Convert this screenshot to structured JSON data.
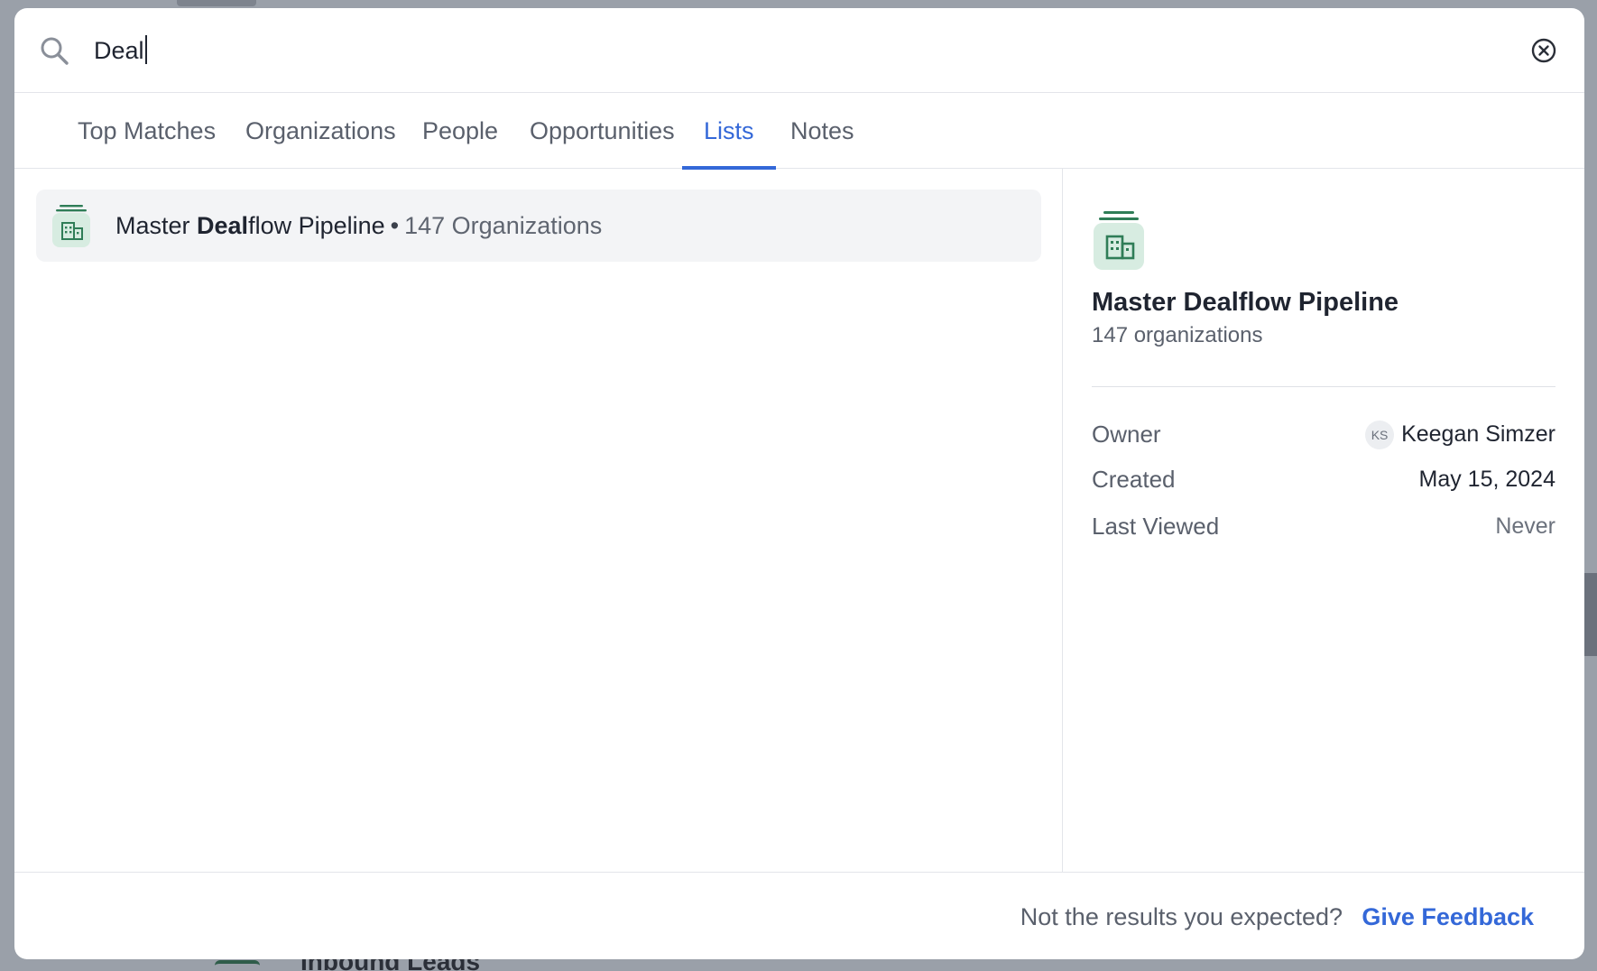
{
  "search": {
    "value": "Deal"
  },
  "tabs": [
    {
      "label": "Top Matches",
      "active": false
    },
    {
      "label": "Organizations",
      "active": false
    },
    {
      "label": "People",
      "active": false
    },
    {
      "label": "Opportunities",
      "active": false
    },
    {
      "label": "Lists",
      "active": true
    },
    {
      "label": "Notes",
      "active": false
    }
  ],
  "results": [
    {
      "name_prefix": "Master ",
      "name_match": "Deal",
      "name_suffix": "flow Pipeline",
      "separator": "•",
      "count": "147 Organizations",
      "icon": "list-organizations-icon"
    }
  ],
  "detail": {
    "title": "Master Dealflow Pipeline",
    "subtitle": "147 organizations",
    "owner_label": "Owner",
    "owner_initials": "KS",
    "owner_name": "Keegan Simzer",
    "created_label": "Created",
    "created_value": "May 15, 2024",
    "last_viewed_label": "Last Viewed",
    "last_viewed_value": "Never"
  },
  "footer": {
    "question": "Not the results you expected?",
    "link": "Give Feedback"
  },
  "background": {
    "underlay_text": "Inbound Leads"
  },
  "colors": {
    "accent": "#3468d8",
    "list_icon_green": "#2f7d57",
    "list_icon_bg": "#d7ece1"
  }
}
